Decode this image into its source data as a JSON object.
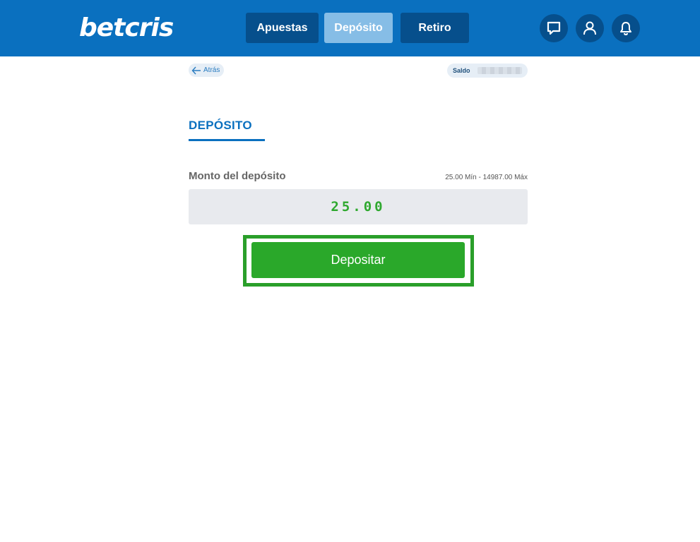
{
  "brand": {
    "logo_text": "betcris",
    "header_color": "#0a70bf"
  },
  "nav": {
    "apuestas": "Apuestas",
    "deposito": "Depósito",
    "retiro": "Retiro"
  },
  "icons": {
    "chat": "chat-icon",
    "user": "user-icon",
    "bell": "bell-icon"
  },
  "back": {
    "label": "Atrás"
  },
  "balance": {
    "label": "Saldo"
  },
  "page": {
    "title": "DEPÓSITO"
  },
  "deposit_form": {
    "amount_label": "Monto del depósito",
    "range_text": "25.00 Mín - 14987.00 Máx",
    "amount_value": "25.00",
    "submit_label": "Depositar",
    "accent_color": "#2aa82a"
  }
}
